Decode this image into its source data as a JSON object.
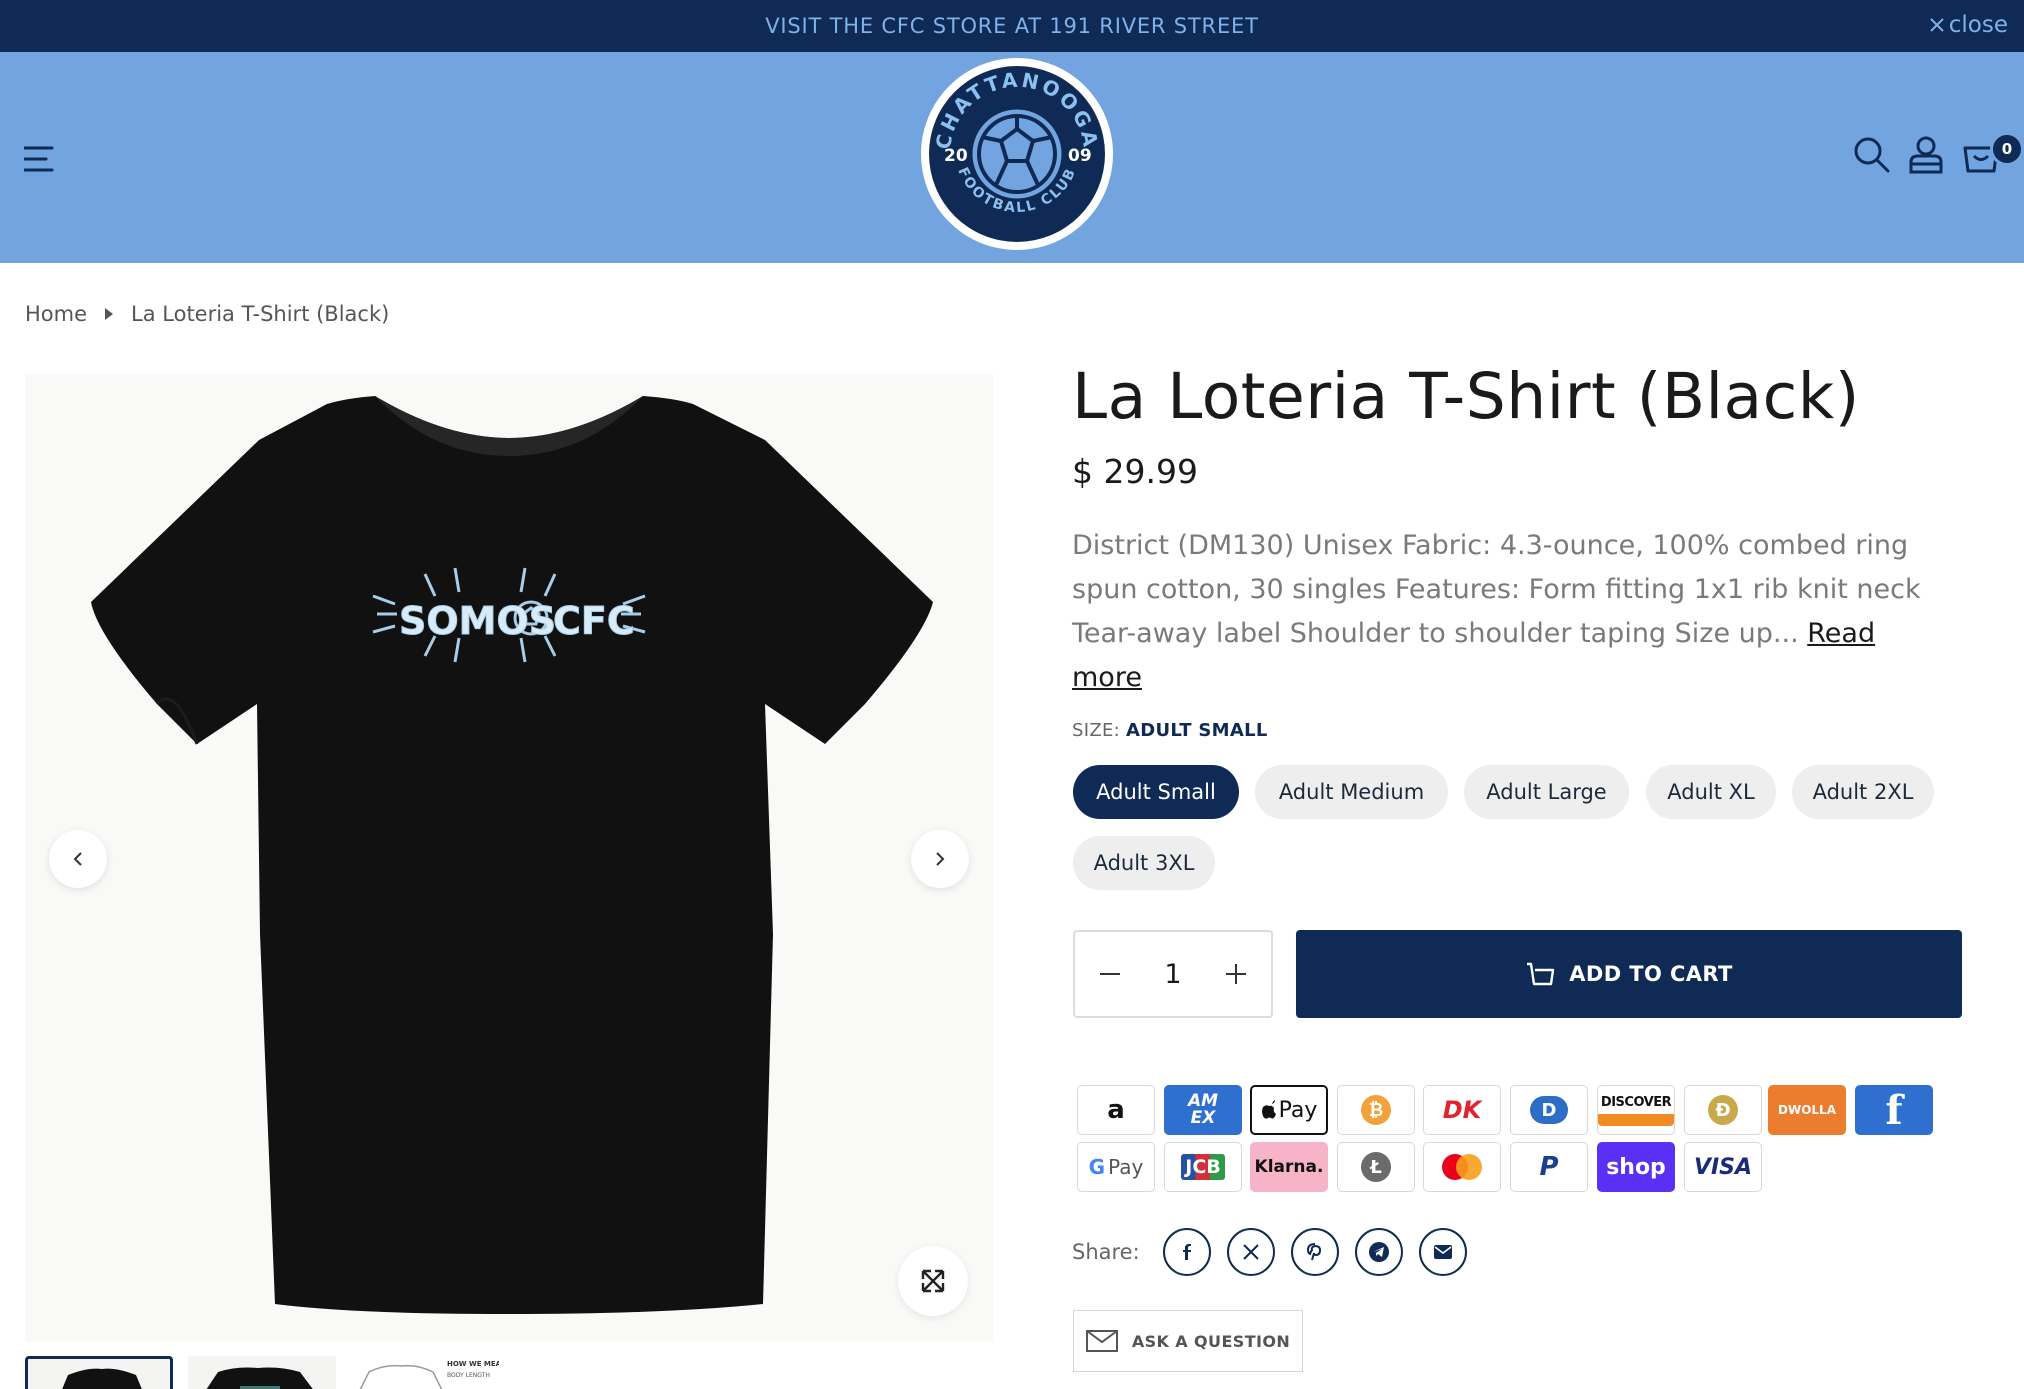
{
  "announcement": {
    "text": "VISIT THE CFC STORE AT 191 RIVER STREET",
    "close_label": "close"
  },
  "header": {
    "logo": {
      "arc_top": "CHATTANOOGA",
      "arc_bottom": "FOOTBALL CLUB",
      "year_left": "20",
      "year_right": "09"
    },
    "cart_count": "0",
    "icons": [
      "menu-icon",
      "search-icon",
      "account-icon",
      "cart-icon"
    ]
  },
  "breadcrumb": {
    "home": "Home",
    "current": "La Loteria T-Shirt (Black)"
  },
  "gallery": {
    "shirt_print": "SOMOS",
    "shirt_print_2": "CFC",
    "thumb_caption": "HOW WE MEASURE",
    "thumb_caption_2": "BODY LENGTH"
  },
  "product": {
    "title": "La Loteria T-Shirt (Black)",
    "price": "$ 29.99",
    "description": "District (DM130) Unisex Fabric: 4.3-ounce, 100% combed ring spun cotton, 30 singles Features: Form fitting 1x1 rib knit neck Tear-away label Shoulder to shoulder taping Size up...",
    "read_more": "Read more",
    "size_label": "SIZE:",
    "selected_size": "ADULT SMALL",
    "sizes": [
      "Adult Small",
      "Adult Medium",
      "Adult Large",
      "Adult XL",
      "Adult 2XL",
      "Adult 3XL"
    ],
    "quantity": "1",
    "add_to_cart": "ADD TO CART"
  },
  "payments": {
    "amazon": "a",
    "amex": "AM EX",
    "applepay": "Pay",
    "bitcoin": "₿",
    "dankort": "DK",
    "diners": "D",
    "discover": "DISCOVER",
    "dogecoin": "Ð",
    "dwolla": "DWOLLA",
    "forbrugs": "f",
    "gpay": "Pay",
    "jcb": "JCB",
    "klarna": "Klarna.",
    "litecoin": "Ł",
    "mastercard": "",
    "paypal": "P",
    "shop": "shop",
    "visa": "VISA"
  },
  "share": {
    "label": "Share:",
    "icons": [
      "facebook-icon",
      "x-icon",
      "pinterest-icon",
      "telegram-icon",
      "email-icon"
    ]
  },
  "ask_question": "ASK A QUESTION",
  "colors": {
    "navy": "#0f2a54",
    "header_blue": "#72a4e0",
    "announce_text": "#7fb1ea"
  }
}
